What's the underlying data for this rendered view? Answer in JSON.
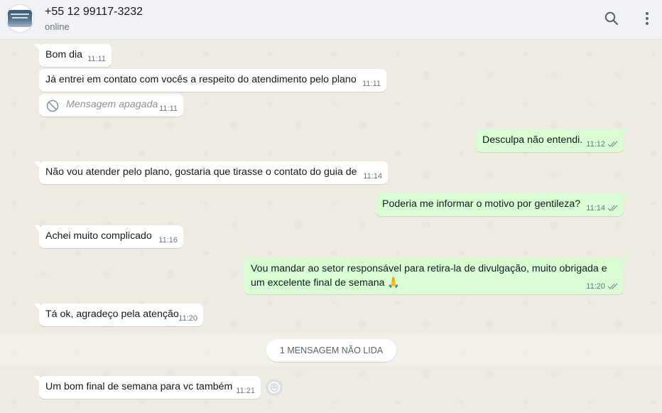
{
  "header": {
    "contact_name": "+55 12 99117-3232",
    "status": "online",
    "icons": [
      "avatar",
      "search-icon",
      "menu-icon"
    ]
  },
  "messages": [
    {
      "dir": "in",
      "text": "Bom dia",
      "time": "11:11"
    },
    {
      "dir": "in",
      "text": "Já entrei em contato com vocês a respeito do atendimento pelo plano",
      "time": "11:11"
    },
    {
      "dir": "in",
      "text": "Mensagem apagada",
      "time": "11:11",
      "deleted": true
    },
    {
      "dir": "out",
      "text": "Desculpa não entendi.",
      "time": "11:12",
      "status": "read"
    },
    {
      "dir": "in",
      "text": "Não vou atender pelo plano, gostaria que tirasse o contato do guia de",
      "time": "11:14"
    },
    {
      "dir": "out",
      "text": "Poderia me informar o motivo por gentileza?",
      "time": "11:14",
      "status": "read"
    },
    {
      "dir": "in",
      "text": "Achei muito complicado",
      "time": "11:16"
    },
    {
      "dir": "out",
      "text": "Vou mandar ao setor responsável para retira-la de divulgação, muito obrigada e",
      "text2": "um excelente final de semana 🙏",
      "time": "11:20",
      "status": "read"
    },
    {
      "dir": "in",
      "text": "Tá ok, agradeço pela atenção",
      "time": "11:20"
    },
    {
      "dir": "in",
      "text": "Um bom final de semana para vc também",
      "time": "11:21"
    }
  ],
  "unread_divider": "1 MENSAGEM NÃO LIDA",
  "colors": {
    "incoming": "#ffffff",
    "outgoing": "#d9fdd3",
    "background": "#efeae2",
    "read_ticks": "#8696a0"
  }
}
